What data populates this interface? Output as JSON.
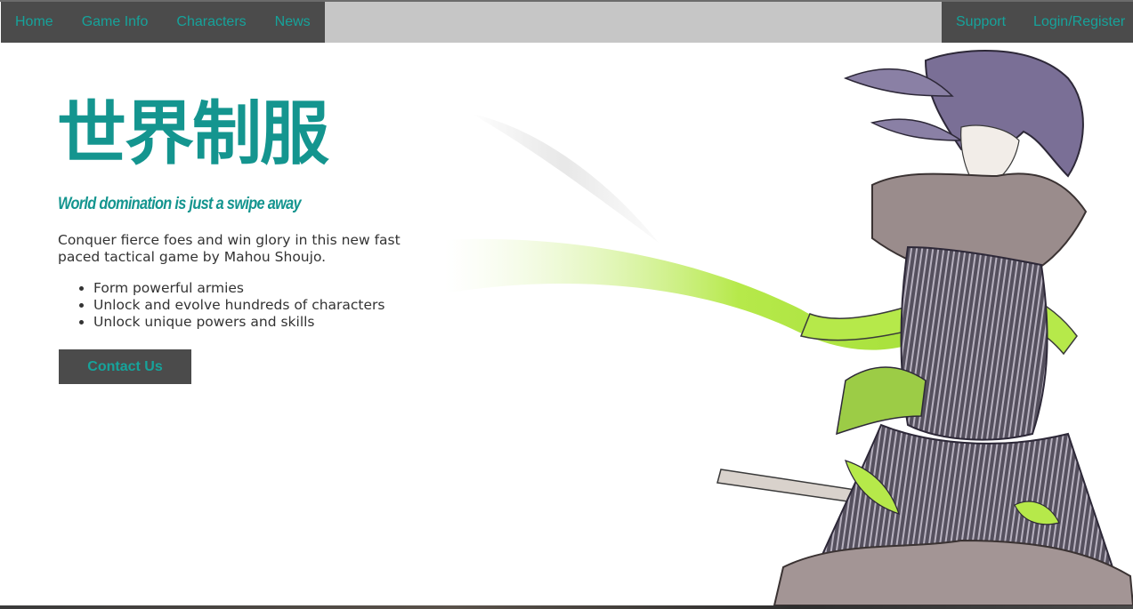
{
  "nav": {
    "left_links": [
      "Home",
      "Game Info",
      "Characters",
      "News"
    ],
    "right_links": [
      "Support",
      "Login/Register"
    ]
  },
  "hero": {
    "title": "世界制服",
    "tagline": "World domination is just a swipe away",
    "description": "Conquer fierce foes and win glory in this new fast paced tactical game by Mahou Shoujo.",
    "features": [
      "Form powerful armies",
      "Unlock and evolve hundreds of characters",
      "Unlock unique powers and skills"
    ],
    "cta_label": "Contact Us"
  },
  "artwork": {
    "description_icon": "anime-character-illustration",
    "colors": {
      "accent": "#14958f",
      "scarf": "#b6e94a",
      "hair": "#7a6f96",
      "coat": "#4a4652",
      "fur": "#9a8c8c"
    }
  }
}
